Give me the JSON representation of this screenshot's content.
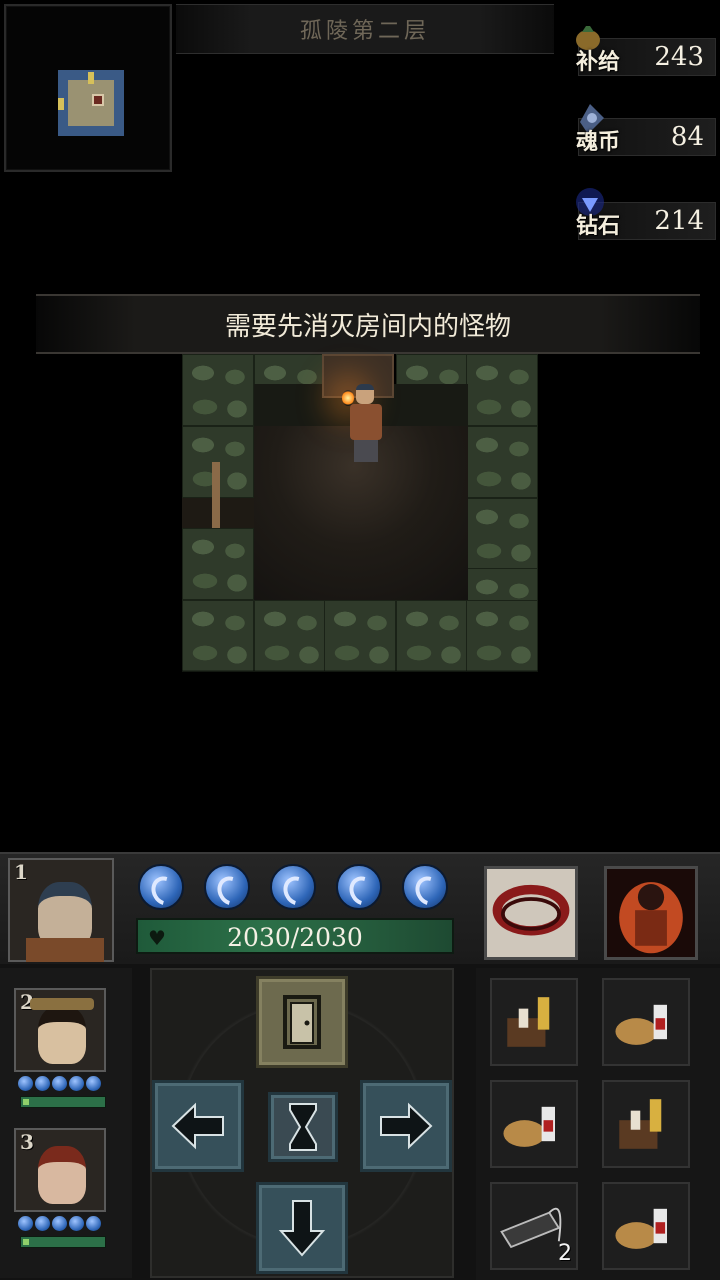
{
  "floor_title": "孤陵第二层",
  "resources": [
    {
      "label": "补给",
      "value": "243",
      "icon": "supply-pouch-icon",
      "color": "#c9a040"
    },
    {
      "label": "魂币",
      "value": "84",
      "icon": "soul-coin-icon",
      "color": "#6f8ab8"
    },
    {
      "label": "钻石",
      "value": "214",
      "icon": "diamond-icon",
      "color": "#4a6aff"
    }
  ],
  "message": "需要先消灭房间内的怪物",
  "party": {
    "leader": {
      "slot": "1",
      "hp_text": "2030/2030",
      "energy_orbs": 5
    },
    "members": [
      {
        "slot": "2",
        "energy_orbs": 5,
        "hp_fraction": 1.0
      },
      {
        "slot": "3",
        "energy_orbs": 5,
        "hp_fraction": 1.0
      }
    ]
  },
  "skills": [
    {
      "name": "whirlwind-slash-skill",
      "color": "#b03030"
    },
    {
      "name": "flame-fist-skill",
      "color": "#d0502a"
    }
  ],
  "controls": [
    "exit-door",
    "move-left",
    "wait",
    "move-right",
    "move-down"
  ],
  "inventory": [
    {
      "icon": "chest-bottle-icon",
      "count": ""
    },
    {
      "icon": "bread-bottle-icon",
      "count": ""
    },
    {
      "icon": "bread-bottle-icon",
      "count": ""
    },
    {
      "icon": "chest-bottle-icon",
      "count": ""
    },
    {
      "icon": "trap-device-icon",
      "count": "2"
    },
    {
      "icon": "bread-bottle-icon",
      "count": ""
    }
  ]
}
